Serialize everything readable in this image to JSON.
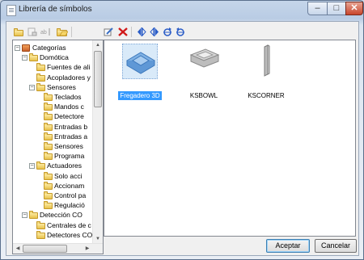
{
  "window": {
    "title": "Librería de símbolos",
    "min": "–",
    "max": "□",
    "close": "✕"
  },
  "toolbar": {
    "icons": [
      "new-folder-icon",
      "new-item-icon",
      "rename-icon",
      "open-folder-icon",
      "edit-icon",
      "delete-icon",
      "flip-horizontal-icon",
      "flip-vertical-icon",
      "rotate-cw-icon",
      "rotate-ccw-icon"
    ]
  },
  "tree": {
    "items": [
      {
        "label": "Categorías",
        "depth": 0,
        "expander": "−",
        "root": true
      },
      {
        "label": "Domótica",
        "depth": 1,
        "expander": "−"
      },
      {
        "label": "Fuentes de ali",
        "depth": 2
      },
      {
        "label": "Acopladores y",
        "depth": 2
      },
      {
        "label": "Sensores",
        "depth": 2,
        "expander": "−"
      },
      {
        "label": "Teclados",
        "depth": 3
      },
      {
        "label": "Mandos c",
        "depth": 3
      },
      {
        "label": "Detectore",
        "depth": 3
      },
      {
        "label": "Entradas b",
        "depth": 3
      },
      {
        "label": "Entradas a",
        "depth": 3
      },
      {
        "label": "Sensores",
        "depth": 3
      },
      {
        "label": "Programa",
        "depth": 3
      },
      {
        "label": "Actuadores",
        "depth": 2,
        "expander": "−"
      },
      {
        "label": "Solo acci",
        "depth": 3
      },
      {
        "label": "Accionam",
        "depth": 3
      },
      {
        "label": "Control pa",
        "depth": 3
      },
      {
        "label": "Regulació",
        "depth": 3
      },
      {
        "label": "Detección CO",
        "depth": 1,
        "expander": "−"
      },
      {
        "label": "Centrales de c",
        "depth": 2
      },
      {
        "label": "Detectores CO",
        "depth": 2
      }
    ],
    "scroll_up": "▲",
    "scroll_down": "▼",
    "scroll_left": "◀",
    "scroll_right": "▶"
  },
  "symbols": [
    {
      "name": "Fregadero 3D",
      "selected": true
    },
    {
      "name": "KSBOWL",
      "selected": false
    },
    {
      "name": "KSCORNER",
      "selected": false
    }
  ],
  "buttons": {
    "accept": "Aceptar",
    "cancel": "Cancelar"
  },
  "colors": {
    "selection": "#3399ff",
    "accent_blue": "#2a5cc7",
    "delete_red": "#d11a1a"
  }
}
